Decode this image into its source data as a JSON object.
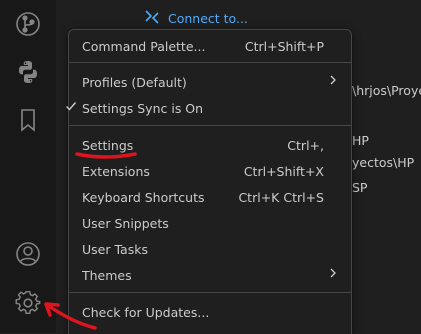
{
  "connect": {
    "label": "Connect to..."
  },
  "menu": {
    "command_palette": {
      "label": "Command Palette...",
      "shortcut": "Ctrl+Shift+P"
    },
    "profiles": {
      "label": "Profiles (Default)"
    },
    "settings_sync": {
      "label": "Settings Sync is On",
      "checked": true
    },
    "settings": {
      "label": "Settings",
      "shortcut": "Ctrl+,"
    },
    "extensions": {
      "label": "Extensions",
      "shortcut": "Ctrl+Shift+X"
    },
    "keyboard_shortcuts": {
      "label": "Keyboard Shortcuts",
      "shortcut": "Ctrl+K Ctrl+S"
    },
    "user_snippets": {
      "label": "User Snippets"
    },
    "user_tasks": {
      "label": "User Tasks"
    },
    "themes": {
      "label": "Themes"
    },
    "check_updates": {
      "label": "Check for Updates..."
    }
  },
  "background": {
    "line1": "\\hrjos\\Proye",
    "line2": "HP",
    "line3": "yectos\\HP",
    "line4": "SP"
  },
  "colors": {
    "accent": "#4daafc",
    "annotation": "#e0141e",
    "menu_bg": "#1f1f1f",
    "activity_bar_bg": "#181818"
  },
  "icons": {
    "activity_bar": [
      "source-control-graph-icon",
      "python-icon",
      "bookmark-icon",
      "account-icon",
      "manage-gear-icon"
    ]
  }
}
